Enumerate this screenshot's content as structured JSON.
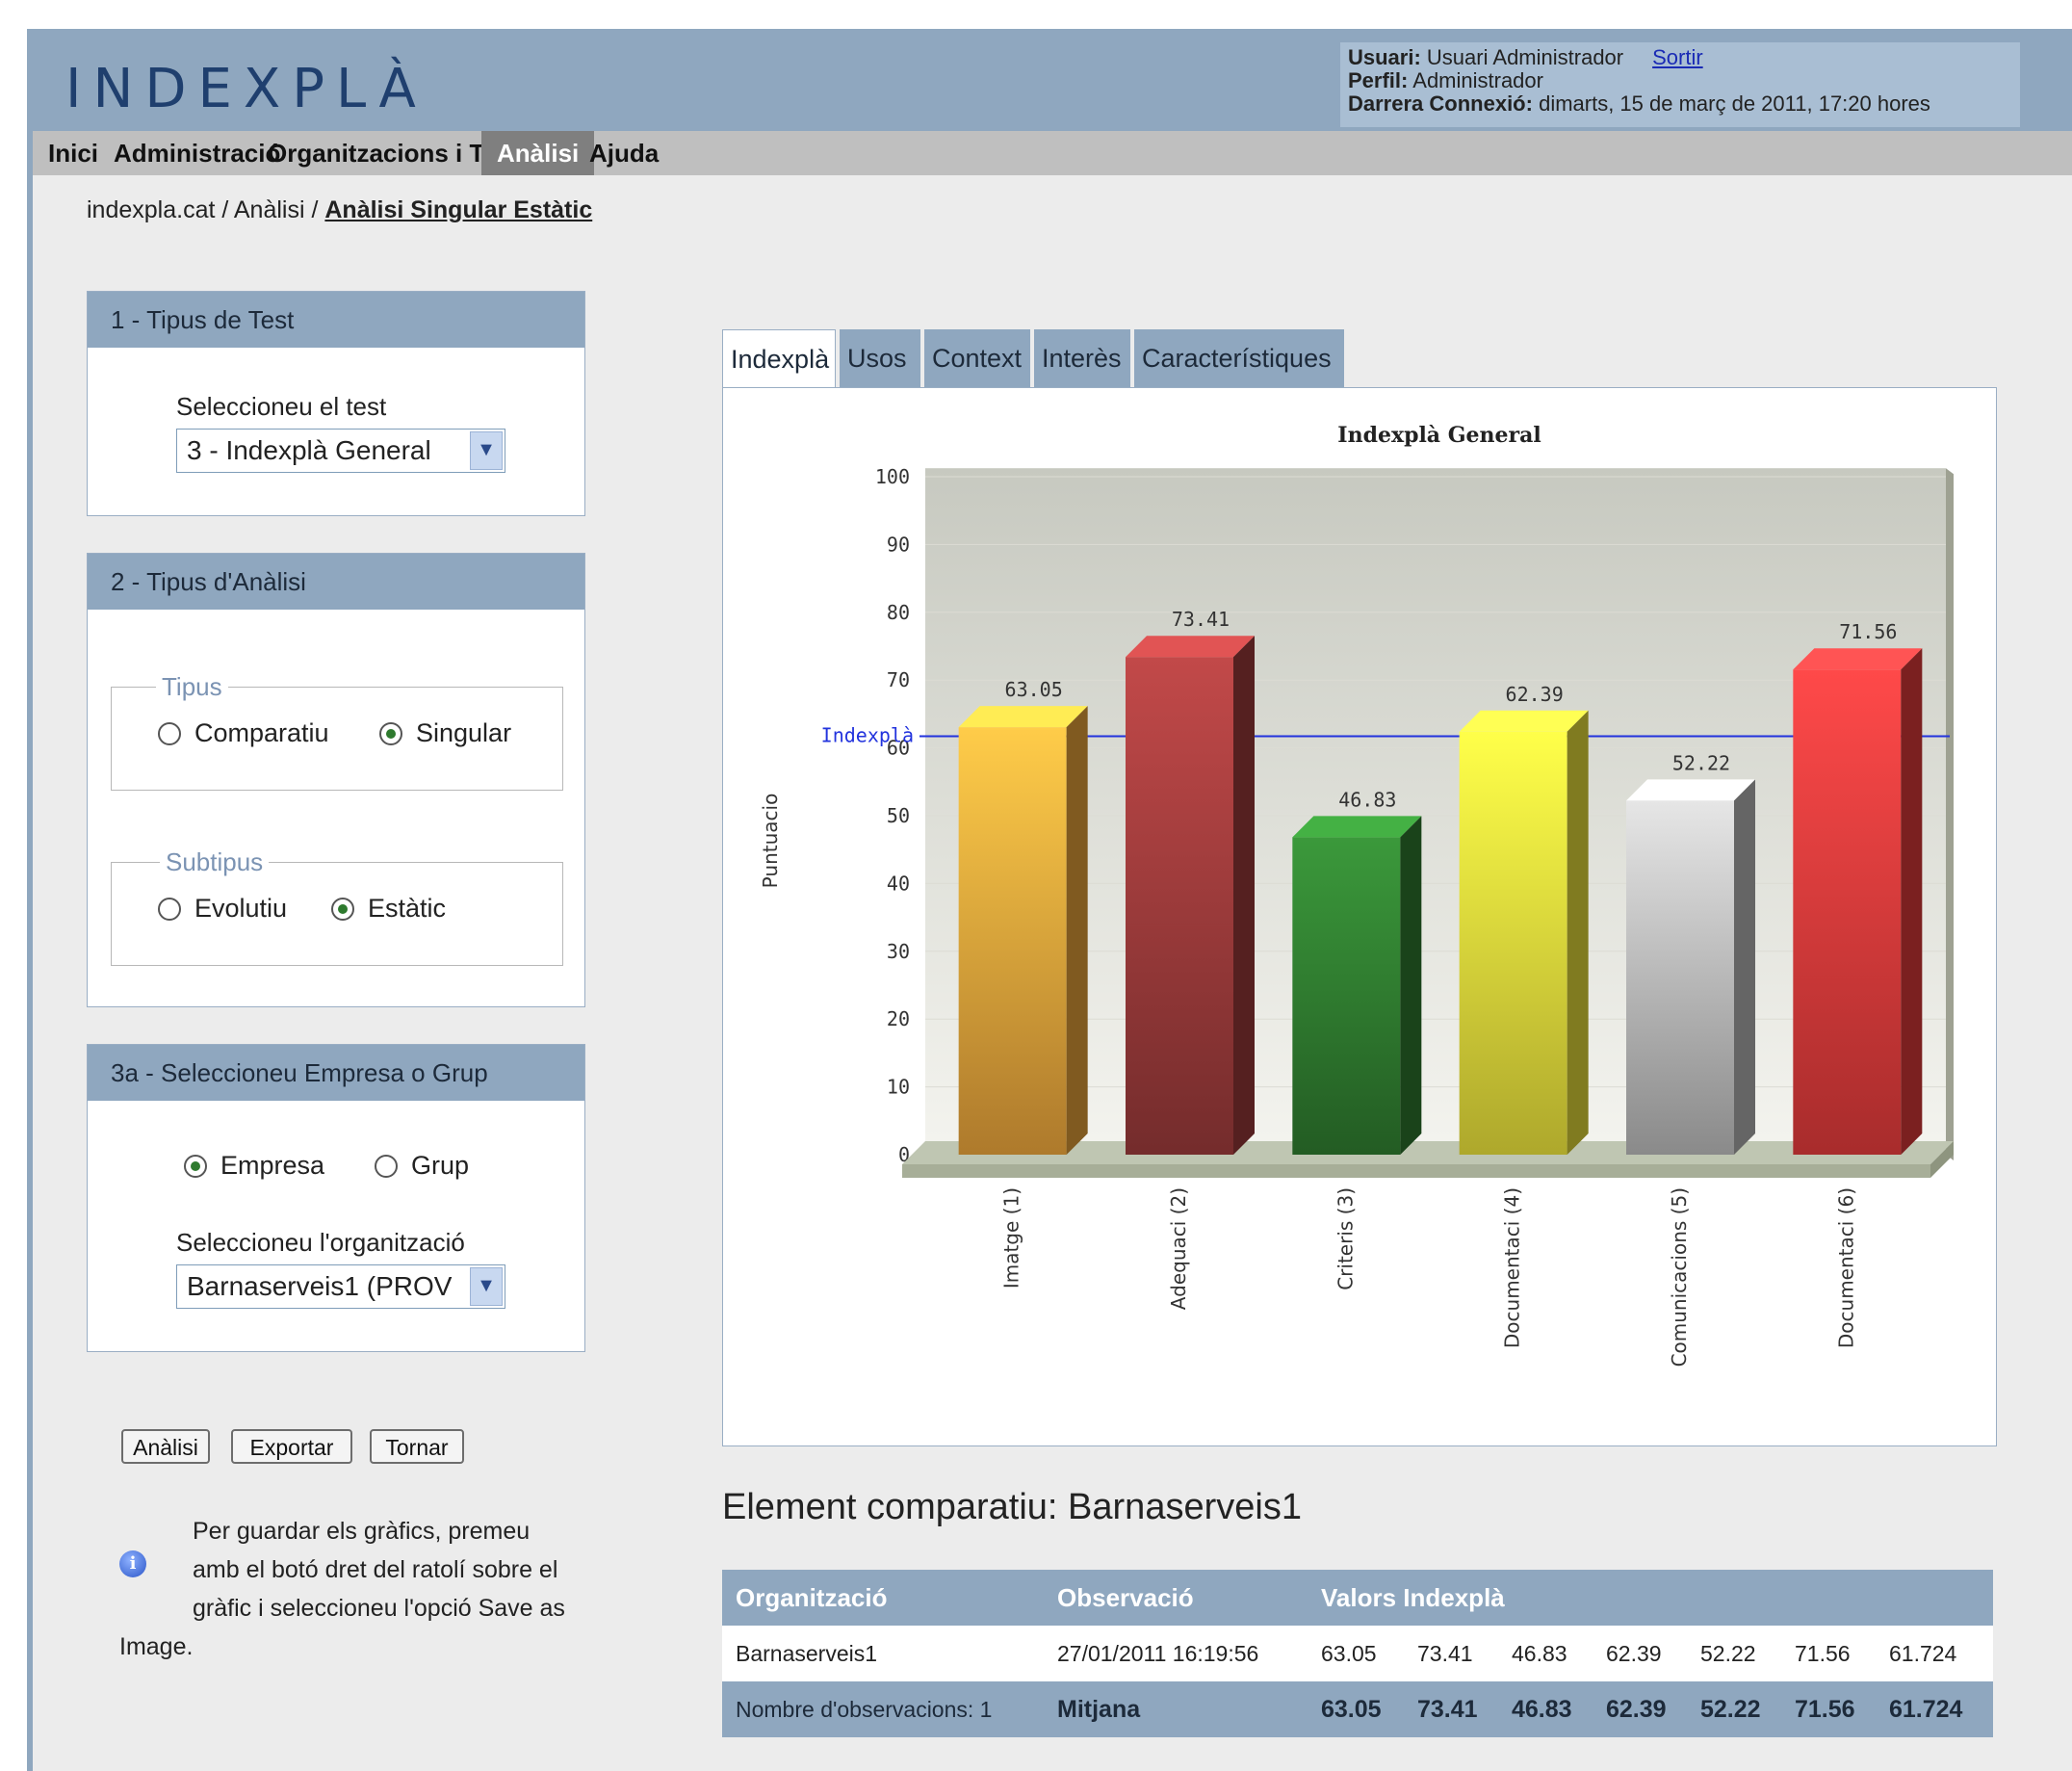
{
  "header": {
    "logo": "INDEXPLÀ",
    "user_label": "Usuari:",
    "user_value": "Usuari Administrador",
    "logout": "Sortir",
    "profile_label": "Perfil:",
    "profile_value": "Administrador",
    "last_label": "Darrera Connexió:",
    "last_value": "dimarts, 15 de març de 2011, 17:20 hores"
  },
  "nav": {
    "items": [
      "Inici",
      "Administració",
      "Organitzacions i Tests",
      "Anàlisi",
      "Ajuda"
    ],
    "active": "Anàlisi"
  },
  "breadcrumb": {
    "path": "indexpla.cat / Anàlisi / ",
    "current": "Anàlisi Singular Estàtic"
  },
  "panel1": {
    "title": "1 - Tipus de Test",
    "label": "Seleccioneu el test",
    "selected": "3 - Indexplà General"
  },
  "panel2": {
    "title": "2 - Tipus d'Anàlisi",
    "tipus_legend": "Tipus",
    "opt_comparatiu": "Comparatiu",
    "opt_singular": "Singular",
    "subtipus_legend": "Subtipus",
    "opt_evolutiu": "Evolutiu",
    "opt_estatic": "Estàtic"
  },
  "panel3": {
    "title": "3a - Seleccioneu Empresa o Grup",
    "opt_empresa": "Empresa",
    "opt_grup": "Grup",
    "label": "Seleccioneu l'organització",
    "selected": "Barnaserveis1 (PROV"
  },
  "buttons": {
    "analisi": "Anàlisi",
    "exportar": "Exportar",
    "tornar": "Tornar"
  },
  "info": {
    "line1": "Per guardar els gràfics, premeu",
    "line2": "amb el botó dret del ratolí sobre el",
    "line3": "gràfic i seleccioneu l'opció Save as",
    "line4": "Image."
  },
  "tabs": [
    "Indexplà",
    "Usos",
    "Context",
    "Interès",
    "Característiques"
  ],
  "chart_data": {
    "type": "bar",
    "title": "Indexplà General",
    "ylabel": "Puntuacio",
    "xlabel": "",
    "ylim": [
      0,
      100
    ],
    "yticks": [
      0,
      10,
      20,
      30,
      40,
      50,
      60,
      70,
      80,
      90,
      100
    ],
    "categories": [
      "Imatge (1)",
      "Adequaci (2)",
      "Criteris (3)",
      "Documentaci (4)",
      "Comunicacions (5)",
      "Documentaci (6)"
    ],
    "values": [
      63.05,
      73.41,
      46.83,
      62.39,
      52.22,
      71.56
    ],
    "value_labels": [
      "63.05",
      "73.41",
      "46.83",
      "62.39",
      "52.22",
      "71.56"
    ],
    "colors": [
      "#e8a33a",
      "#9b3a3a",
      "#2f7a2f",
      "#e8e03a",
      "#b8b8b8",
      "#e03a3a"
    ],
    "reference_line": {
      "label": "Indexplà",
      "value": 61.724,
      "color": "#2233dd"
    },
    "grid": true
  },
  "compare": {
    "title": "Element comparatiu: Barnaserveis1",
    "headers": [
      "Organització",
      "Observació",
      "Valors Indexplà"
    ],
    "row": {
      "org": "Barnaserveis1",
      "obs": "27/01/2011 16:19:56",
      "values": [
        "63.05",
        "73.41",
        "46.83",
        "62.39",
        "52.22",
        "71.56",
        "61.724"
      ]
    },
    "summary": {
      "count": "Nombre d'observacions: 1",
      "label": "Mitjana",
      "values": [
        "63.05",
        "73.41",
        "46.83",
        "62.39",
        "52.22",
        "71.56",
        "61.724"
      ]
    }
  }
}
